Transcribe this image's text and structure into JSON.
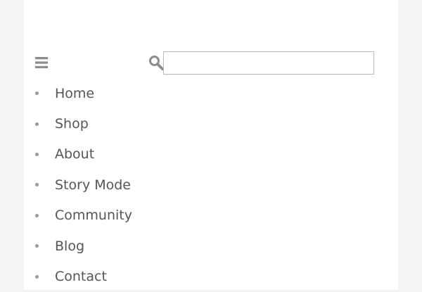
{
  "header": {
    "menu_icon": "hamburger-menu-icon",
    "search_icon": "search-icon",
    "search": {
      "value": "",
      "placeholder": ""
    }
  },
  "nav": {
    "items": [
      {
        "label": "Home"
      },
      {
        "label": "Shop"
      },
      {
        "label": "About"
      },
      {
        "label": "Story Mode"
      },
      {
        "label": "Community"
      },
      {
        "label": "Blog"
      },
      {
        "label": "Contact"
      }
    ]
  },
  "colors": {
    "page_background": "#f4f4f4",
    "panel_background": "#ffffff",
    "text": "#555555",
    "icon": "#8c8c8c",
    "bullet": "#9a9a9a",
    "input_border": "#b9b9b9"
  }
}
